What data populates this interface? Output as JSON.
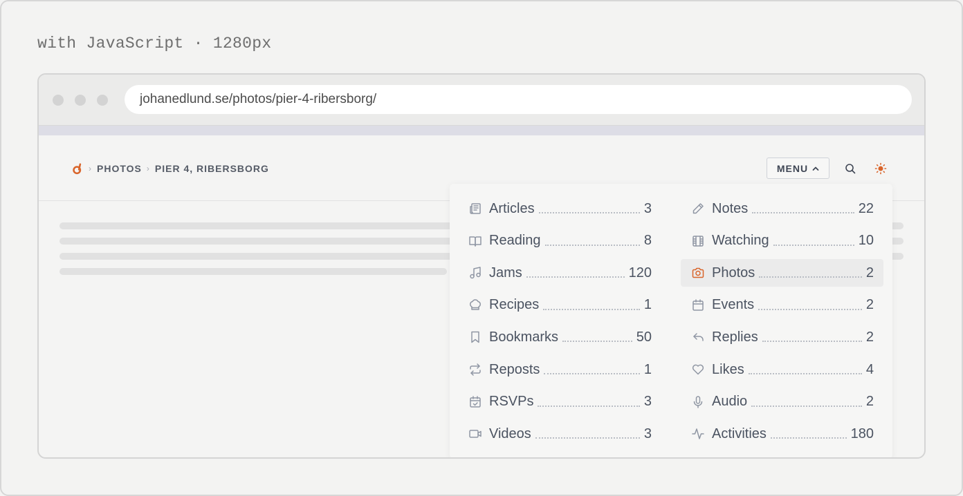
{
  "caption": "with JavaScript · 1280px",
  "browser": {
    "url": "johanedlund.se/photos/pier-4-ribersborg/"
  },
  "breadcrumb": {
    "section": "PHOTOS",
    "page": "PIER 4, RIBERSBORG"
  },
  "header": {
    "menu_label": "MENU"
  },
  "colors": {
    "accent": "#d9652b",
    "text": "#3f4654",
    "muted_icon": "#8f96a3"
  },
  "menu": {
    "left": [
      {
        "label": "Articles",
        "count": "3",
        "icon": "newspaper-icon"
      },
      {
        "label": "Reading",
        "count": "8",
        "icon": "book-open-icon"
      },
      {
        "label": "Jams",
        "count": "120",
        "icon": "music-note-icon"
      },
      {
        "label": "Recipes",
        "count": "1",
        "icon": "chef-hat-icon"
      },
      {
        "label": "Bookmarks",
        "count": "50",
        "icon": "bookmark-icon"
      },
      {
        "label": "Reposts",
        "count": "1",
        "icon": "repeat-icon"
      },
      {
        "label": "RSVPs",
        "count": "3",
        "icon": "calendar-check-icon"
      },
      {
        "label": "Videos",
        "count": "3",
        "icon": "video-camera-icon"
      }
    ],
    "right": [
      {
        "label": "Notes",
        "count": "22",
        "icon": "pencil-icon"
      },
      {
        "label": "Watching",
        "count": "10",
        "icon": "film-icon"
      },
      {
        "label": "Photos",
        "count": "2",
        "icon": "camera-icon",
        "active": true
      },
      {
        "label": "Events",
        "count": "2",
        "icon": "calendar-icon"
      },
      {
        "label": "Replies",
        "count": "2",
        "icon": "reply-arrow-icon"
      },
      {
        "label": "Likes",
        "count": "4",
        "icon": "heart-icon"
      },
      {
        "label": "Audio",
        "count": "2",
        "icon": "microphone-icon"
      },
      {
        "label": "Activities",
        "count": "180",
        "icon": "activity-pulse-icon"
      }
    ]
  }
}
